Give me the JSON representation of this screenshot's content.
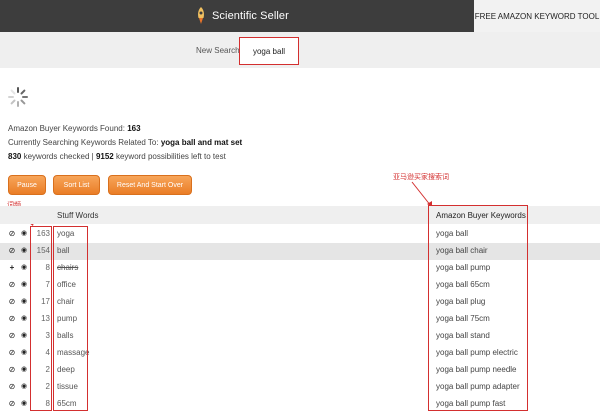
{
  "header": {
    "brand": "Scientific Seller",
    "tool_tab": "FREE AMAZON KEYWORD TOOL"
  },
  "search": {
    "label": "New Search",
    "value": "yoga ball"
  },
  "info": {
    "found_label": "Amazon Buyer Keywords Found:",
    "found_count": "163",
    "searching_label": "Currently Searching Keywords Related To:",
    "searching_value": "yoga ball and mat set",
    "checked_count": "830",
    "checked_text": "keywords checked |",
    "left_count": "9152",
    "left_text": "keyword possibilities left to test"
  },
  "buttons": {
    "pause": "Pause",
    "sort": "Sort List",
    "reset": "Reset And Start Over"
  },
  "annotations": {
    "frequency": "词频",
    "amazon_keywords": "亚马逊买家搜索词"
  },
  "table": {
    "stuff_header": "Stuff Words",
    "amazon_header": "Amazon Buyer Keywords",
    "rows": [
      {
        "count": "163",
        "word": "yoga",
        "keyword": "yoga ball",
        "added": false,
        "struck": false,
        "highlight": false
      },
      {
        "count": "154",
        "word": "ball",
        "keyword": "yoga ball chair",
        "added": false,
        "struck": false,
        "highlight": true
      },
      {
        "count": "8",
        "word": "chairs",
        "keyword": "yoga ball pump",
        "added": true,
        "struck": true,
        "highlight": false
      },
      {
        "count": "7",
        "word": "office",
        "keyword": "yoga ball 65cm",
        "added": false,
        "struck": false,
        "highlight": false
      },
      {
        "count": "17",
        "word": "chair",
        "keyword": "yoga ball plug",
        "added": false,
        "struck": false,
        "highlight": false
      },
      {
        "count": "13",
        "word": "pump",
        "keyword": "yoga ball 75cm",
        "added": false,
        "struck": false,
        "highlight": false
      },
      {
        "count": "3",
        "word": "balls",
        "keyword": "yoga ball stand",
        "added": false,
        "struck": false,
        "highlight": false
      },
      {
        "count": "4",
        "word": "massage",
        "keyword": "yoga ball pump electric",
        "added": false,
        "struck": false,
        "highlight": false
      },
      {
        "count": "2",
        "word": "deep",
        "keyword": "yoga ball pump needle",
        "added": false,
        "struck": false,
        "highlight": false
      },
      {
        "count": "2",
        "word": "tissue",
        "keyword": "yoga ball pump adapter",
        "added": false,
        "struck": false,
        "highlight": false
      },
      {
        "count": "8",
        "word": "65cm",
        "keyword": "yoga ball pump fast",
        "added": false,
        "struck": false,
        "highlight": false
      }
    ]
  }
}
